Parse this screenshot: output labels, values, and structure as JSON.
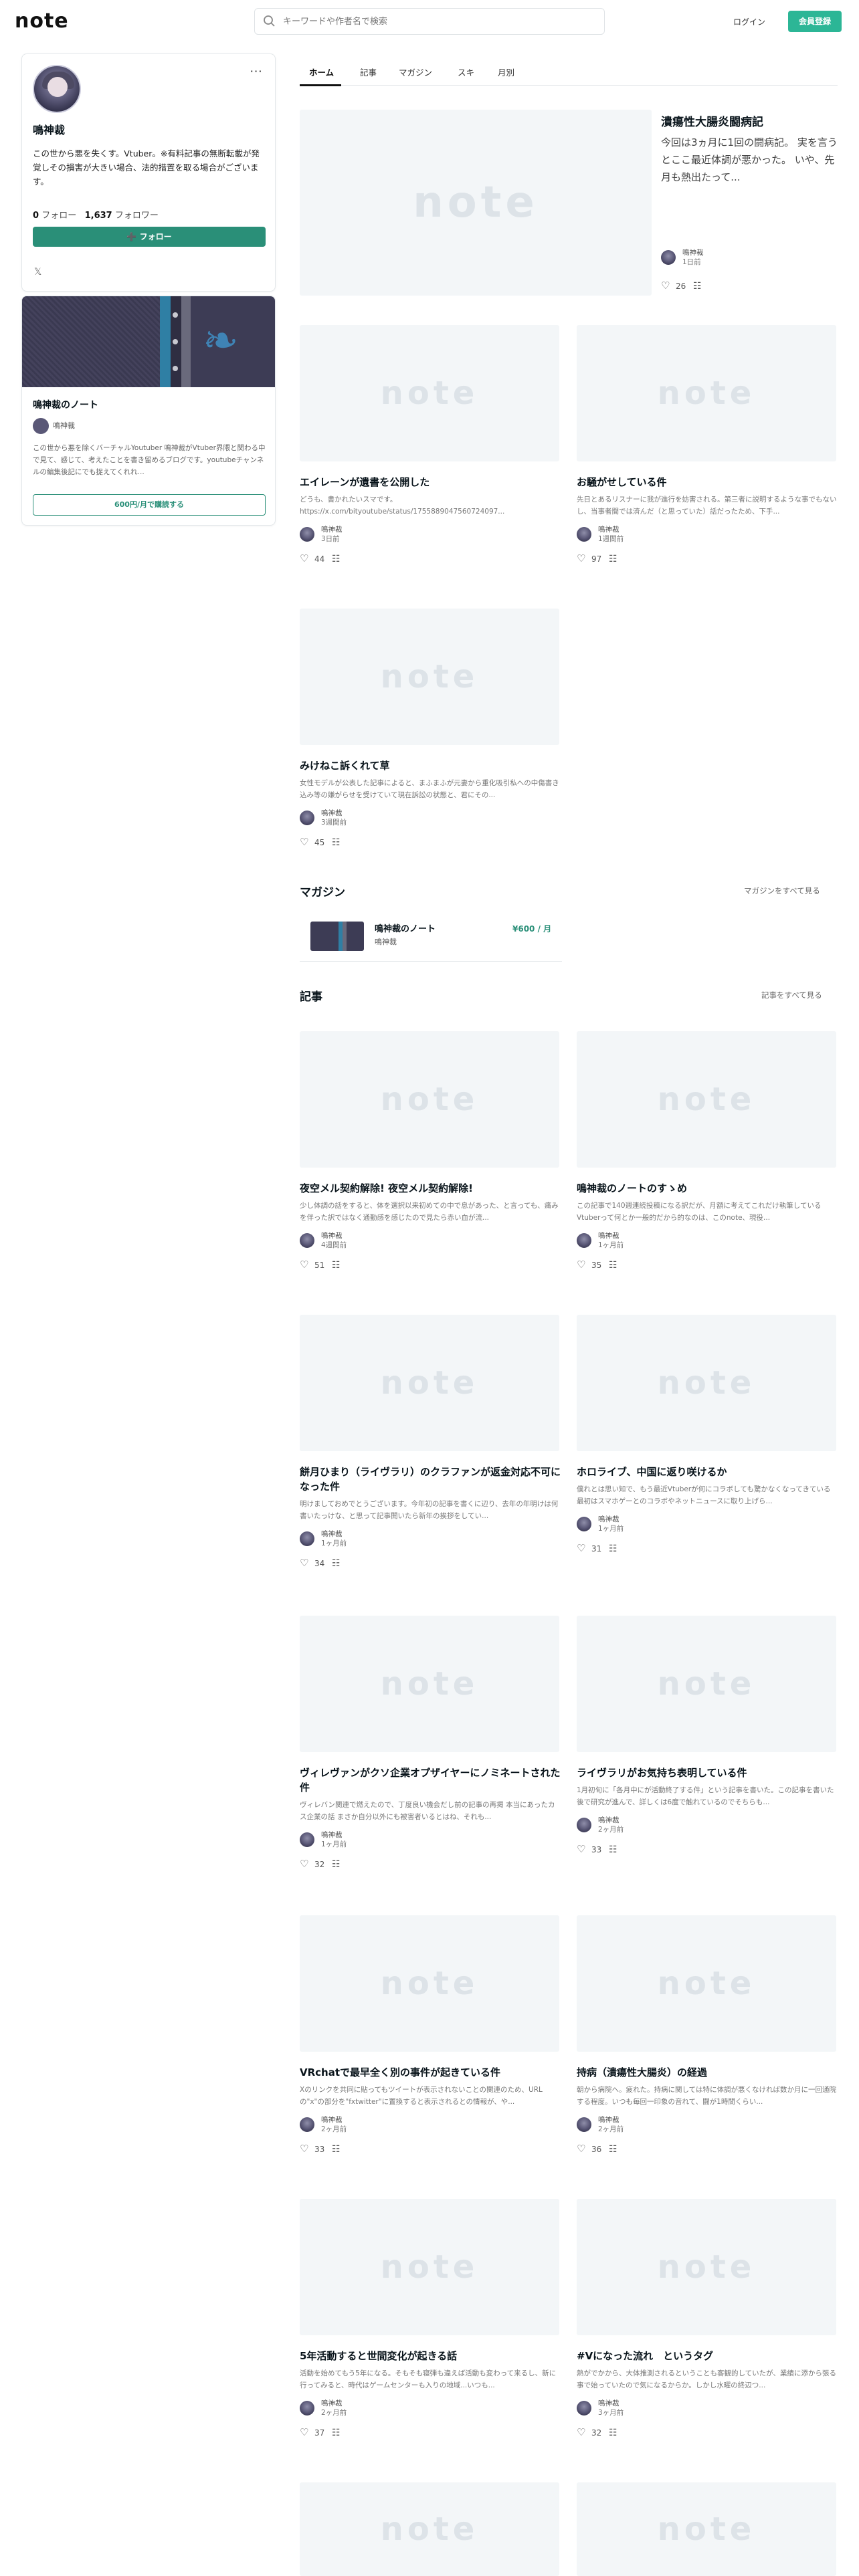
{
  "header": {
    "logo": "note",
    "search_placeholder": "キーワードや作者名で検索",
    "login_label": "ログイン",
    "signup_label": "会員登録"
  },
  "profile": {
    "name": "鳴神裁",
    "description": "この世から悪を失くす。Vtuber。※有料記事の無断転載が発覚しその損害が大きい場合、法的措置を取る場合がございます。",
    "follow_count": "0",
    "follow_label": "フォロー",
    "follower_count": "1,637",
    "follower_label": "フォロワー",
    "follow_button": "フォロー",
    "more_icon": "more-icon",
    "x_icon": "x-icon"
  },
  "sidebar_magazine": {
    "title": "鳴神裁のノート",
    "author": "鳴神裁",
    "description": "この世から悪を除くバーチャルYoutuber 鳴神裁がVtuber界隈と関わる中で見て、感じて、考えたことを書き留めるブログです。youtubeチャンネルの編集後記にでも捉えてくれれ...",
    "subscribe_label": "600円/月で購読する"
  },
  "tabs": [
    {
      "label": "ホーム",
      "active": true
    },
    {
      "label": "記事",
      "active": false
    },
    {
      "label": "マガジン",
      "active": false
    },
    {
      "label": "スキ",
      "active": false
    },
    {
      "label": "月別",
      "active": false
    }
  ],
  "featured": {
    "title": "潰瘍性大腸炎闘病記",
    "excerpt": "今回は3ヵ月に1回の闘病記。 実を言うとここ最近体調が悪かった。 いや、先月も熱出たって...",
    "author": "鳴神裁",
    "date": "1日前",
    "likes": "26"
  },
  "home_notes": [
    {
      "title": "エイレーンが遺書を公開した",
      "excerpt": "どうも、書かれたいスマです。 https://x.com/bityoutube/status/1755889047560724097...",
      "author": "鳴神裁",
      "date": "3日前",
      "likes": "44"
    },
    {
      "title": "お騒がせしている件",
      "excerpt": "先日とあるリスナーに我が進行を妨害される。第三者に説明するような事でもないし、当事者間では済んだ（と思っていた）話だったため、下手...",
      "author": "鳴神裁",
      "date": "1週間前",
      "likes": "97"
    },
    {
      "title": "みけねこ訴くれて草",
      "excerpt": "女性モデルが公表した記事によると、まふまふが元妻から重化吸引私への中傷書き込み等の嫌がらせを受けていて現在訴訟の状態と、君にその...",
      "author": "鳴神裁",
      "date": "3週間前",
      "likes": "45"
    }
  ],
  "magazines_section": {
    "heading": "マガジン",
    "see_all": "マガジンをすべて見る",
    "items": [
      {
        "title": "鳴神裁のノート",
        "author": "鳴神裁",
        "price": "¥600 / 月"
      }
    ]
  },
  "articles_section": {
    "heading": "記事",
    "see_all": "記事をすべて見る",
    "items": [
      {
        "title": "夜空メル契約解除! 夜空メル契約解除!",
        "excerpt": "少し体調の話をすると、体を選択以来初めての中で息があった、と言っても、痛みを伴った訳ではなく通勤感を感じたので見たら赤い血が流...",
        "author": "鳴神裁",
        "date": "4週間前",
        "likes": "51"
      },
      {
        "title": "鳴神裁のノートのすゝめ",
        "excerpt": "この記事で140週連続投稿になる訳だが、月額に考えてこれだけ執筆しているVtuberって何とか一般的だから的なのは、このnote、現役...",
        "author": "鳴神裁",
        "date": "1ヶ月前",
        "likes": "35"
      },
      {
        "title": "餅月ひまり（ライヴラリ）のクラファンが返金対応不可になった件",
        "excerpt": "明けましておめでとうございます。今年初の記事を書くに辺り、去年の年明けは何書いたっけな、と思って記事開いたら新年の挨拶をしてい...",
        "author": "鳴神裁",
        "date": "1ヶ月前",
        "likes": "34"
      },
      {
        "title": "ホロライブ、中国に返り咲けるか",
        "excerpt": "僕れとは思い知で、もう最近Vtuberが何にコラボしても驚かなくなってきている 最初はスマホゲーとのコラボやネットニュースに取り上げら...",
        "author": "鳴神裁",
        "date": "1ヶ月前",
        "likes": "31"
      },
      {
        "title": "ヴィレヴァンがクソ企業オプザイヤーにノミネートされた件",
        "excerpt": "ヴィレバン関連で燃えたので、丁度良い機会だし前の記事の再掲 本当にあったカス企業の話 まさか自分以外にも被害者いるとはね、それも...",
        "author": "鳴神裁",
        "date": "1ヶ月前",
        "likes": "32"
      },
      {
        "title": "ライヴラリがお気持ち表明している件",
        "excerpt": "1月初旬に「各月中にが活動終了する件」という記事を書いた。この記事を書いた後で研究が進んで、詳しくは6度で触れているのでそちらも...",
        "author": "鳴神裁",
        "date": "2ヶ月前",
        "likes": "33"
      },
      {
        "title": "VRchatで最早全く別の事件が起きている件",
        "excerpt": "Xのリンクを共同に貼ってもツイートが表示されないことの関連のため、URLの\"x\"の部分を\"fxtwitter\"に置換すると表示されるとの情報が、や...",
        "author": "鳴神裁",
        "date": "2ヶ月前",
        "likes": "33"
      },
      {
        "title": "持病（潰瘍性大腸炎）の経過",
        "excerpt": "朝から病院へ。疲れた。持病に関しては特に体調が悪くなければ数か月に一回通院する程度。いつも毎回一印象の音れて、闘が1時間くらい...",
        "author": "鳴神裁",
        "date": "2ヶ月前",
        "likes": "36"
      },
      {
        "title": "5年活動すると世間変化が起きる話",
        "excerpt": "活動を始めてもう5年になる。そもそも寝弾も違えば活動も変わって来るし、新に行ってみると、時代はゲームセンターも入りの地域...いつも...",
        "author": "鳴神裁",
        "date": "2ヶ月前",
        "likes": "37"
      },
      {
        "title": "#Vになった流れ　というタグ",
        "excerpt": "熱がでかから、大体推測されるということも客観的していたが、業績に添から張る事で始っていたので気になるからか。しかし水曜の終辺つ...",
        "author": "鳴神裁",
        "date": "3ヶ月前",
        "likes": "32"
      }
    ]
  }
}
